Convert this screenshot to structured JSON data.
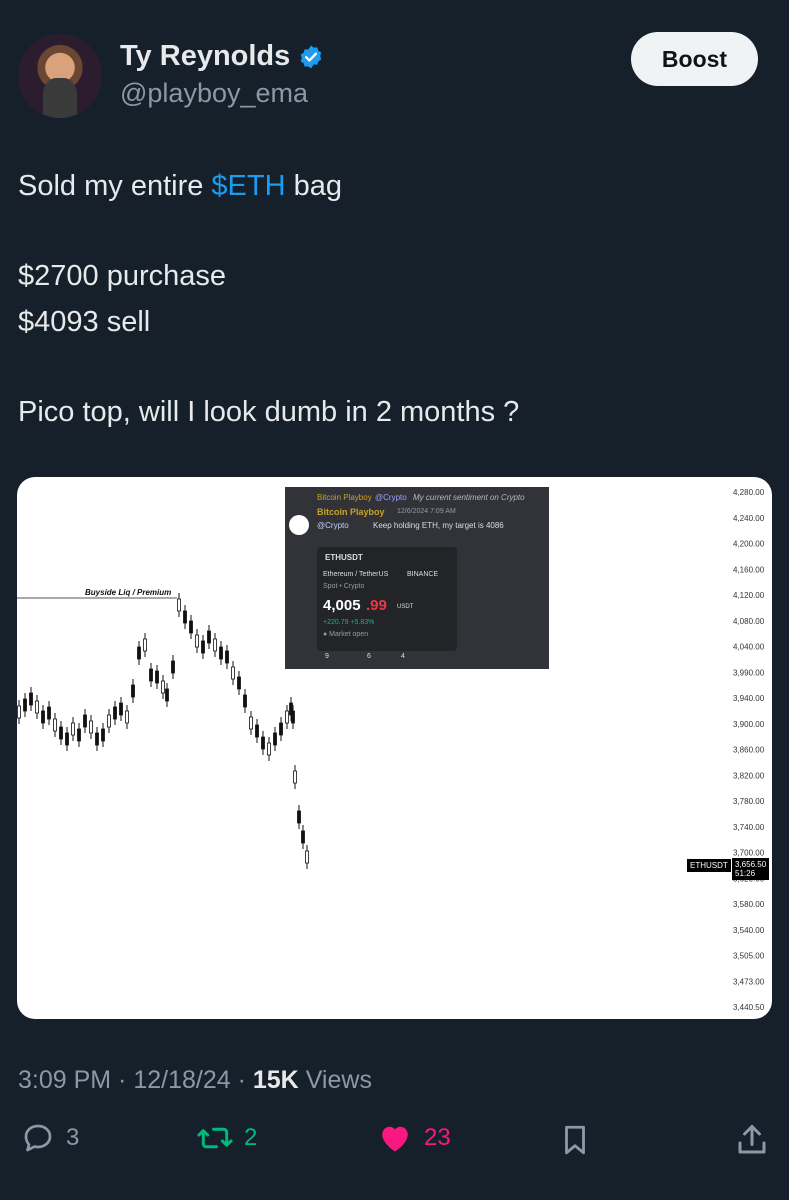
{
  "author": {
    "name": "Ty Reynolds",
    "handle": "@playboy_ema"
  },
  "boost_label": "Boost",
  "tweet": {
    "line1_pre": "Sold my entire ",
    "line1_tag": "$ETH",
    "line1_post": " bag",
    "line2": "$2700 purchase",
    "line3": "$4093 sell",
    "line4": "Pico top, will I look dumb in 2 months ?"
  },
  "chart": {
    "annotation": "Buyside Liq / Premium",
    "axis_labels": [
      "4,280.00",
      "4,240.00",
      "4,200.00",
      "4,160.00",
      "4,120.00",
      "4,080.00",
      "4,040.00",
      "3,990.00",
      "3,940.00",
      "3,900.00",
      "3,860.00",
      "3,820.00",
      "3,780.00",
      "3,740.00",
      "3,700.00",
      "3,620.00",
      "3,580.00",
      "3,540.00",
      "3,505.00",
      "3,473.00",
      "3,440.50"
    ],
    "ticker_tag": "ETHUSDT",
    "current_price": "3,656.50",
    "current_timer": "51:26"
  },
  "inset": {
    "header_name": "Bitcoin Playboy",
    "header_channel": "@Crypto",
    "header_msg": "My current sentiment on Crypto",
    "author": "Bitcoin Playboy",
    "timestamp": "12/6/2024 7:09 AM",
    "mention": "@Crypto",
    "message": "Keep holding ETH, my target is 4086",
    "symbol": "ETHUSDT",
    "pair": "Ethereum / TetherUS",
    "exchange": "BINANCE",
    "market_type": "Spot • Crypto",
    "price_main": "4,005",
    "price_dec": ".99",
    "price_unit": "USDT",
    "change": "+220.79  +5.83%",
    "status": "● Market open",
    "reactions": [
      "9",
      "6",
      "4"
    ]
  },
  "meta": {
    "time": "3:09 PM",
    "date": "12/18/24",
    "views_count": "15K",
    "views_label": "Views"
  },
  "actions": {
    "replies": "3",
    "reposts": "2",
    "likes": "23"
  },
  "colors": {
    "accent": "#1d9bf0",
    "repost": "#00ba7c",
    "like": "#f91880",
    "background": "#15202b"
  }
}
